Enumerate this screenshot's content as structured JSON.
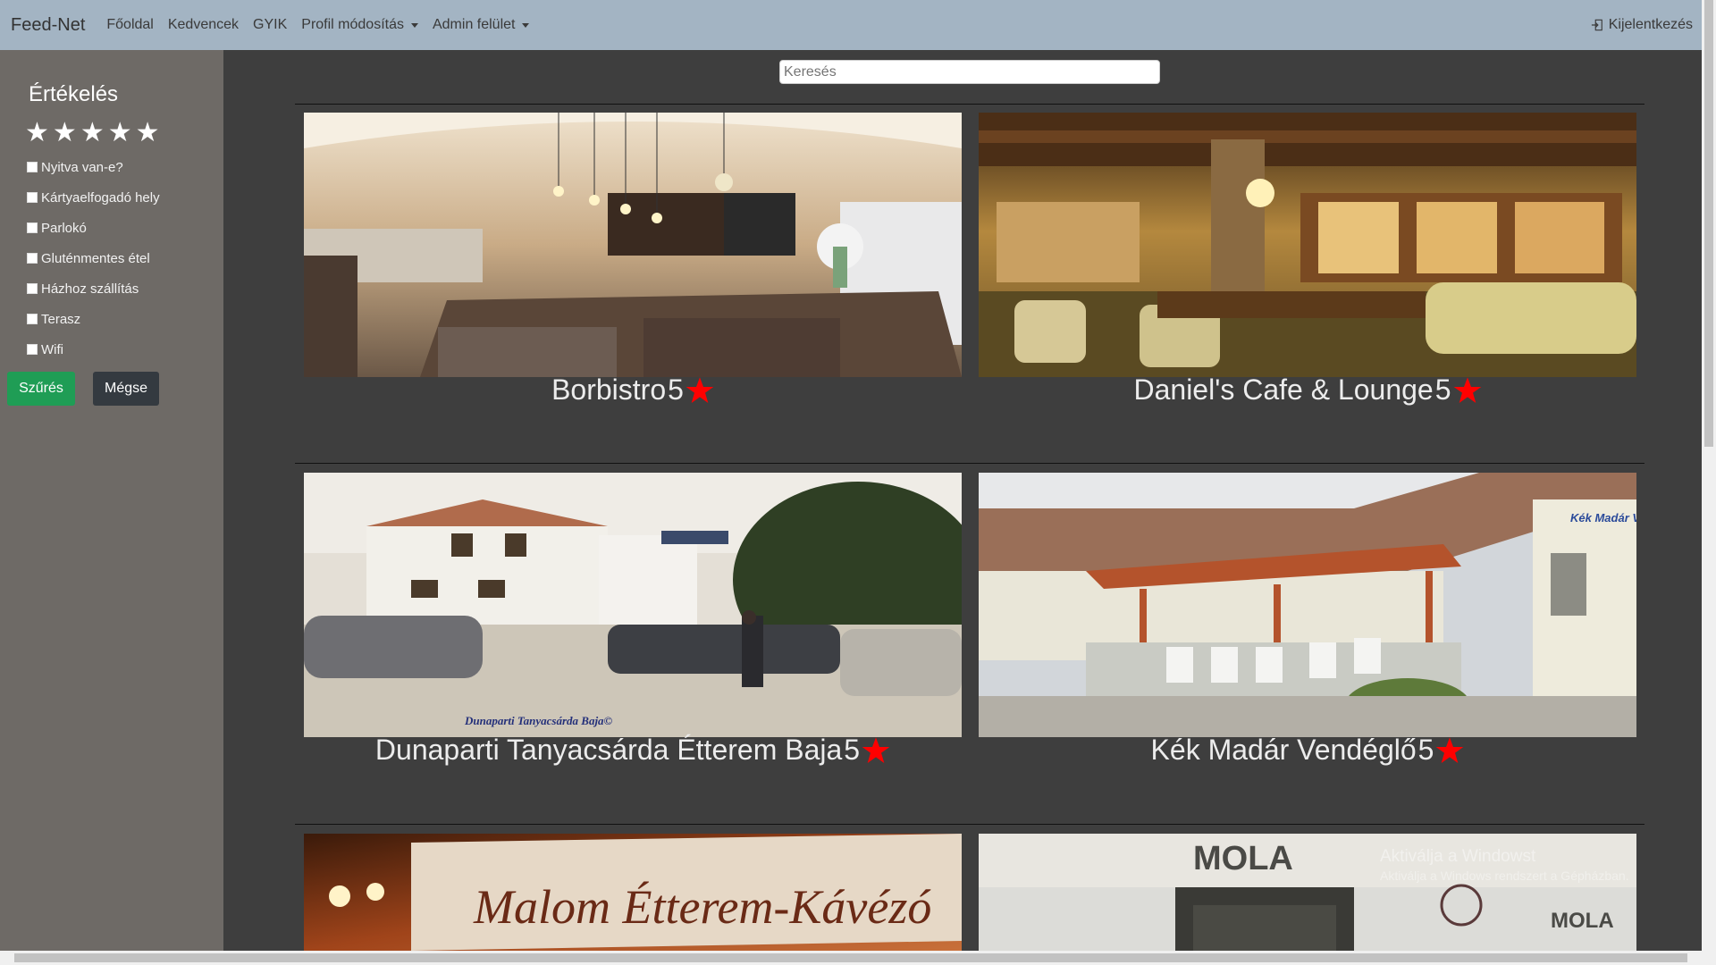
{
  "navbar": {
    "brand": "Feed-Net",
    "items": [
      "Főoldal",
      "Kedvencek",
      "GYIK"
    ],
    "dropdowns": [
      "Profil módosítás",
      "Admin felület"
    ],
    "logout": "Kijelentkezés"
  },
  "sidebar": {
    "title": "Értékelés",
    "stars": [
      "★",
      "★",
      "★",
      "★",
      "★"
    ],
    "filters": [
      "Nyitva van-e?",
      "Kártyaelfogadó hely",
      "Parlokó",
      "Gluténmentes étel",
      "Házhoz szállítás",
      "Terasz",
      "Wifi"
    ],
    "filter_button": "Szűrés",
    "cancel_button": "Mégse"
  },
  "search": {
    "placeholder": "Keresés"
  },
  "restaurants": [
    {
      "name": "Borbistro",
      "rating": "5"
    },
    {
      "name": "Daniel's Cafe & Lounge",
      "rating": "5"
    },
    {
      "name": "Dunaparti Tanyacsárda Étterem Baja",
      "rating": "5"
    },
    {
      "name": "Kék Madár Vendéglő",
      "rating": "5"
    }
  ],
  "images": {
    "dunaparti_caption": "Dunaparti Tanyacsárda Baja©",
    "kek_madar_sign": "Kék Madár Vendéglő",
    "malom_sign": "Malom Étterem-Kávézó",
    "mola_sign": "MOLA"
  },
  "watermark": {
    "line1": "Aktiválja a Windowst",
    "line2": "Aktiválja a Windows rendszert a Gépházban."
  },
  "colors": {
    "navbar": "#a3b4c3",
    "sidebar": "#6e6a66",
    "content": "#3e3e3e",
    "filter_btn": "#1f9d55",
    "star": "#ff0000"
  }
}
